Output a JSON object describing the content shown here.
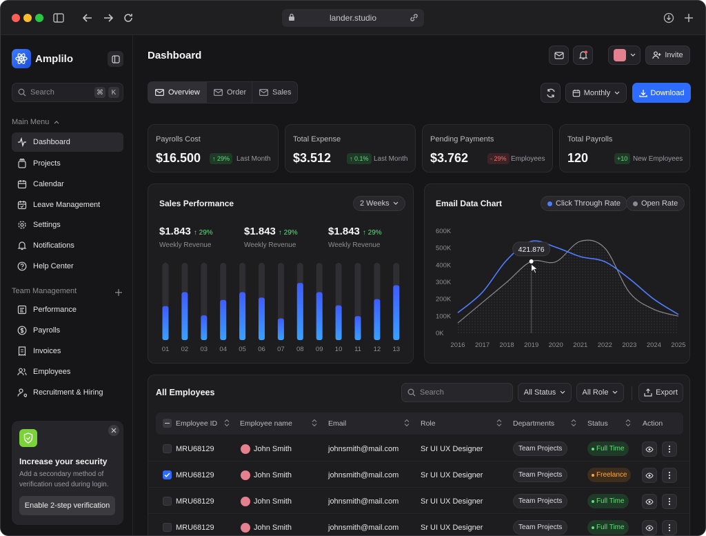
{
  "browser": {
    "url": "lander.studio"
  },
  "app": {
    "name": "Amplilo",
    "search_placeholder": "Search",
    "kbd1": "⌘",
    "kbd2": "K"
  },
  "sidebar": {
    "main_menu_label": "Main Menu",
    "main_items": [
      {
        "label": "Dashboard"
      },
      {
        "label": "Projects"
      },
      {
        "label": "Calendar"
      },
      {
        "label": "Leave Management"
      },
      {
        "label": "Settings"
      },
      {
        "label": "Notifications"
      },
      {
        "label": "Help Center"
      }
    ],
    "team_label": "Team Management",
    "team_items": [
      {
        "label": "Performance"
      },
      {
        "label": "Payrolls"
      },
      {
        "label": "Invoices"
      },
      {
        "label": "Employees"
      },
      {
        "label": "Recruitment & Hiring"
      }
    ],
    "security": {
      "title": "Increase your security",
      "description": "Add a secondary method of verification used during login.",
      "button": "Enable 2-step verification"
    }
  },
  "header": {
    "title": "Dashboard",
    "invite": "Invite"
  },
  "toolbar": {
    "tabs": [
      {
        "label": "Overview"
      },
      {
        "label": "Order"
      },
      {
        "label": "Sales"
      }
    ],
    "period": "Monthly",
    "download": "Download"
  },
  "stats": [
    {
      "label": "Payrolls Cost",
      "value": "$16.500",
      "badge": "29%",
      "trend": "up",
      "sub": "Last Month"
    },
    {
      "label": "Total Expense",
      "value": "$3.512",
      "badge": "0.1%",
      "trend": "up",
      "sub": "Last Month"
    },
    {
      "label": "Pending Payments",
      "value": "$3.762",
      "badge": "- 29%",
      "trend": "down",
      "sub": "Employees"
    },
    {
      "label": "Total Payrolls",
      "value": "120",
      "badge": "+10",
      "trend": "up",
      "sub": "New Employees"
    }
  ],
  "sales": {
    "title": "Sales Performance",
    "range": "2 Weeks",
    "revenues": [
      {
        "value": "$1.843",
        "pct": "29%",
        "label": "Weekly Revenue"
      },
      {
        "value": "$1.843",
        "pct": "29%",
        "label": "Weekly Revenue"
      },
      {
        "value": "$1.843",
        "pct": "29%",
        "label": "Weekly Revenue"
      }
    ]
  },
  "email": {
    "title": "Email Data Chart",
    "legend_ctr": "Click Through Rate",
    "legend_open": "Open Rate",
    "tooltip": "421.876"
  },
  "chart_data": [
    {
      "type": "bar",
      "categories": [
        "01",
        "02",
        "03",
        "04",
        "05",
        "06",
        "07",
        "08",
        "09",
        "10",
        "11",
        "12",
        "13"
      ],
      "values": [
        0.44,
        0.62,
        0.32,
        0.52,
        0.62,
        0.55,
        0.28,
        0.74,
        0.62,
        0.45,
        0.31,
        0.53,
        0.71
      ],
      "ylim": [
        0,
        1
      ]
    },
    {
      "type": "line",
      "x": [
        "2016",
        "2017",
        "2018",
        "2019",
        "2020",
        "2021",
        "2022",
        "2023",
        "2024",
        "2025"
      ],
      "y_ticks": [
        "0K",
        "100K",
        "200K",
        "300K",
        "400K",
        "500K",
        "600K"
      ],
      "ylim": [
        0,
        600000
      ],
      "series": [
        {
          "name": "Click Through Rate",
          "color": "#4f7dff",
          "values": [
            120000,
            240000,
            430000,
            540000,
            505000,
            450000,
            420000,
            320000,
            200000,
            110000
          ]
        },
        {
          "name": "Open Rate",
          "color": "#8a8a90",
          "values": [
            60000,
            180000,
            300000,
            421876,
            420000,
            540000,
            500000,
            240000,
            140000,
            100000
          ]
        }
      ]
    }
  ],
  "employees": {
    "title": "All Employees",
    "search_placeholder": "Search",
    "status_filter": "All Status",
    "role_filter": "All Role",
    "export": "Export",
    "columns": [
      "Employee ID",
      "Employee name",
      "Email",
      "Role",
      "Departments",
      "Status",
      "Action"
    ],
    "rows": [
      {
        "id": "MRU68129",
        "name": "John Smith",
        "email": "johnsmith@mail.com",
        "role": "Sr UI UX Designer",
        "dept": "Team Projects",
        "status": "Full Time",
        "checked": false
      },
      {
        "id": "MRU68129",
        "name": "John Smith",
        "email": "johnsmith@mail.com",
        "role": "Sr UI UX Designer",
        "dept": "Team Projects",
        "status": "Freelance",
        "checked": true
      },
      {
        "id": "MRU68129",
        "name": "John Smith",
        "email": "johnsmith@mail.com",
        "role": "Sr UI UX Designer",
        "dept": "Team Projects",
        "status": "Full Time",
        "checked": false
      },
      {
        "id": "MRU68129",
        "name": "John Smith",
        "email": "johnsmith@mail.com",
        "role": "Sr UI UX Designer",
        "dept": "Team Projects",
        "status": "Full Time",
        "checked": false
      }
    ]
  }
}
